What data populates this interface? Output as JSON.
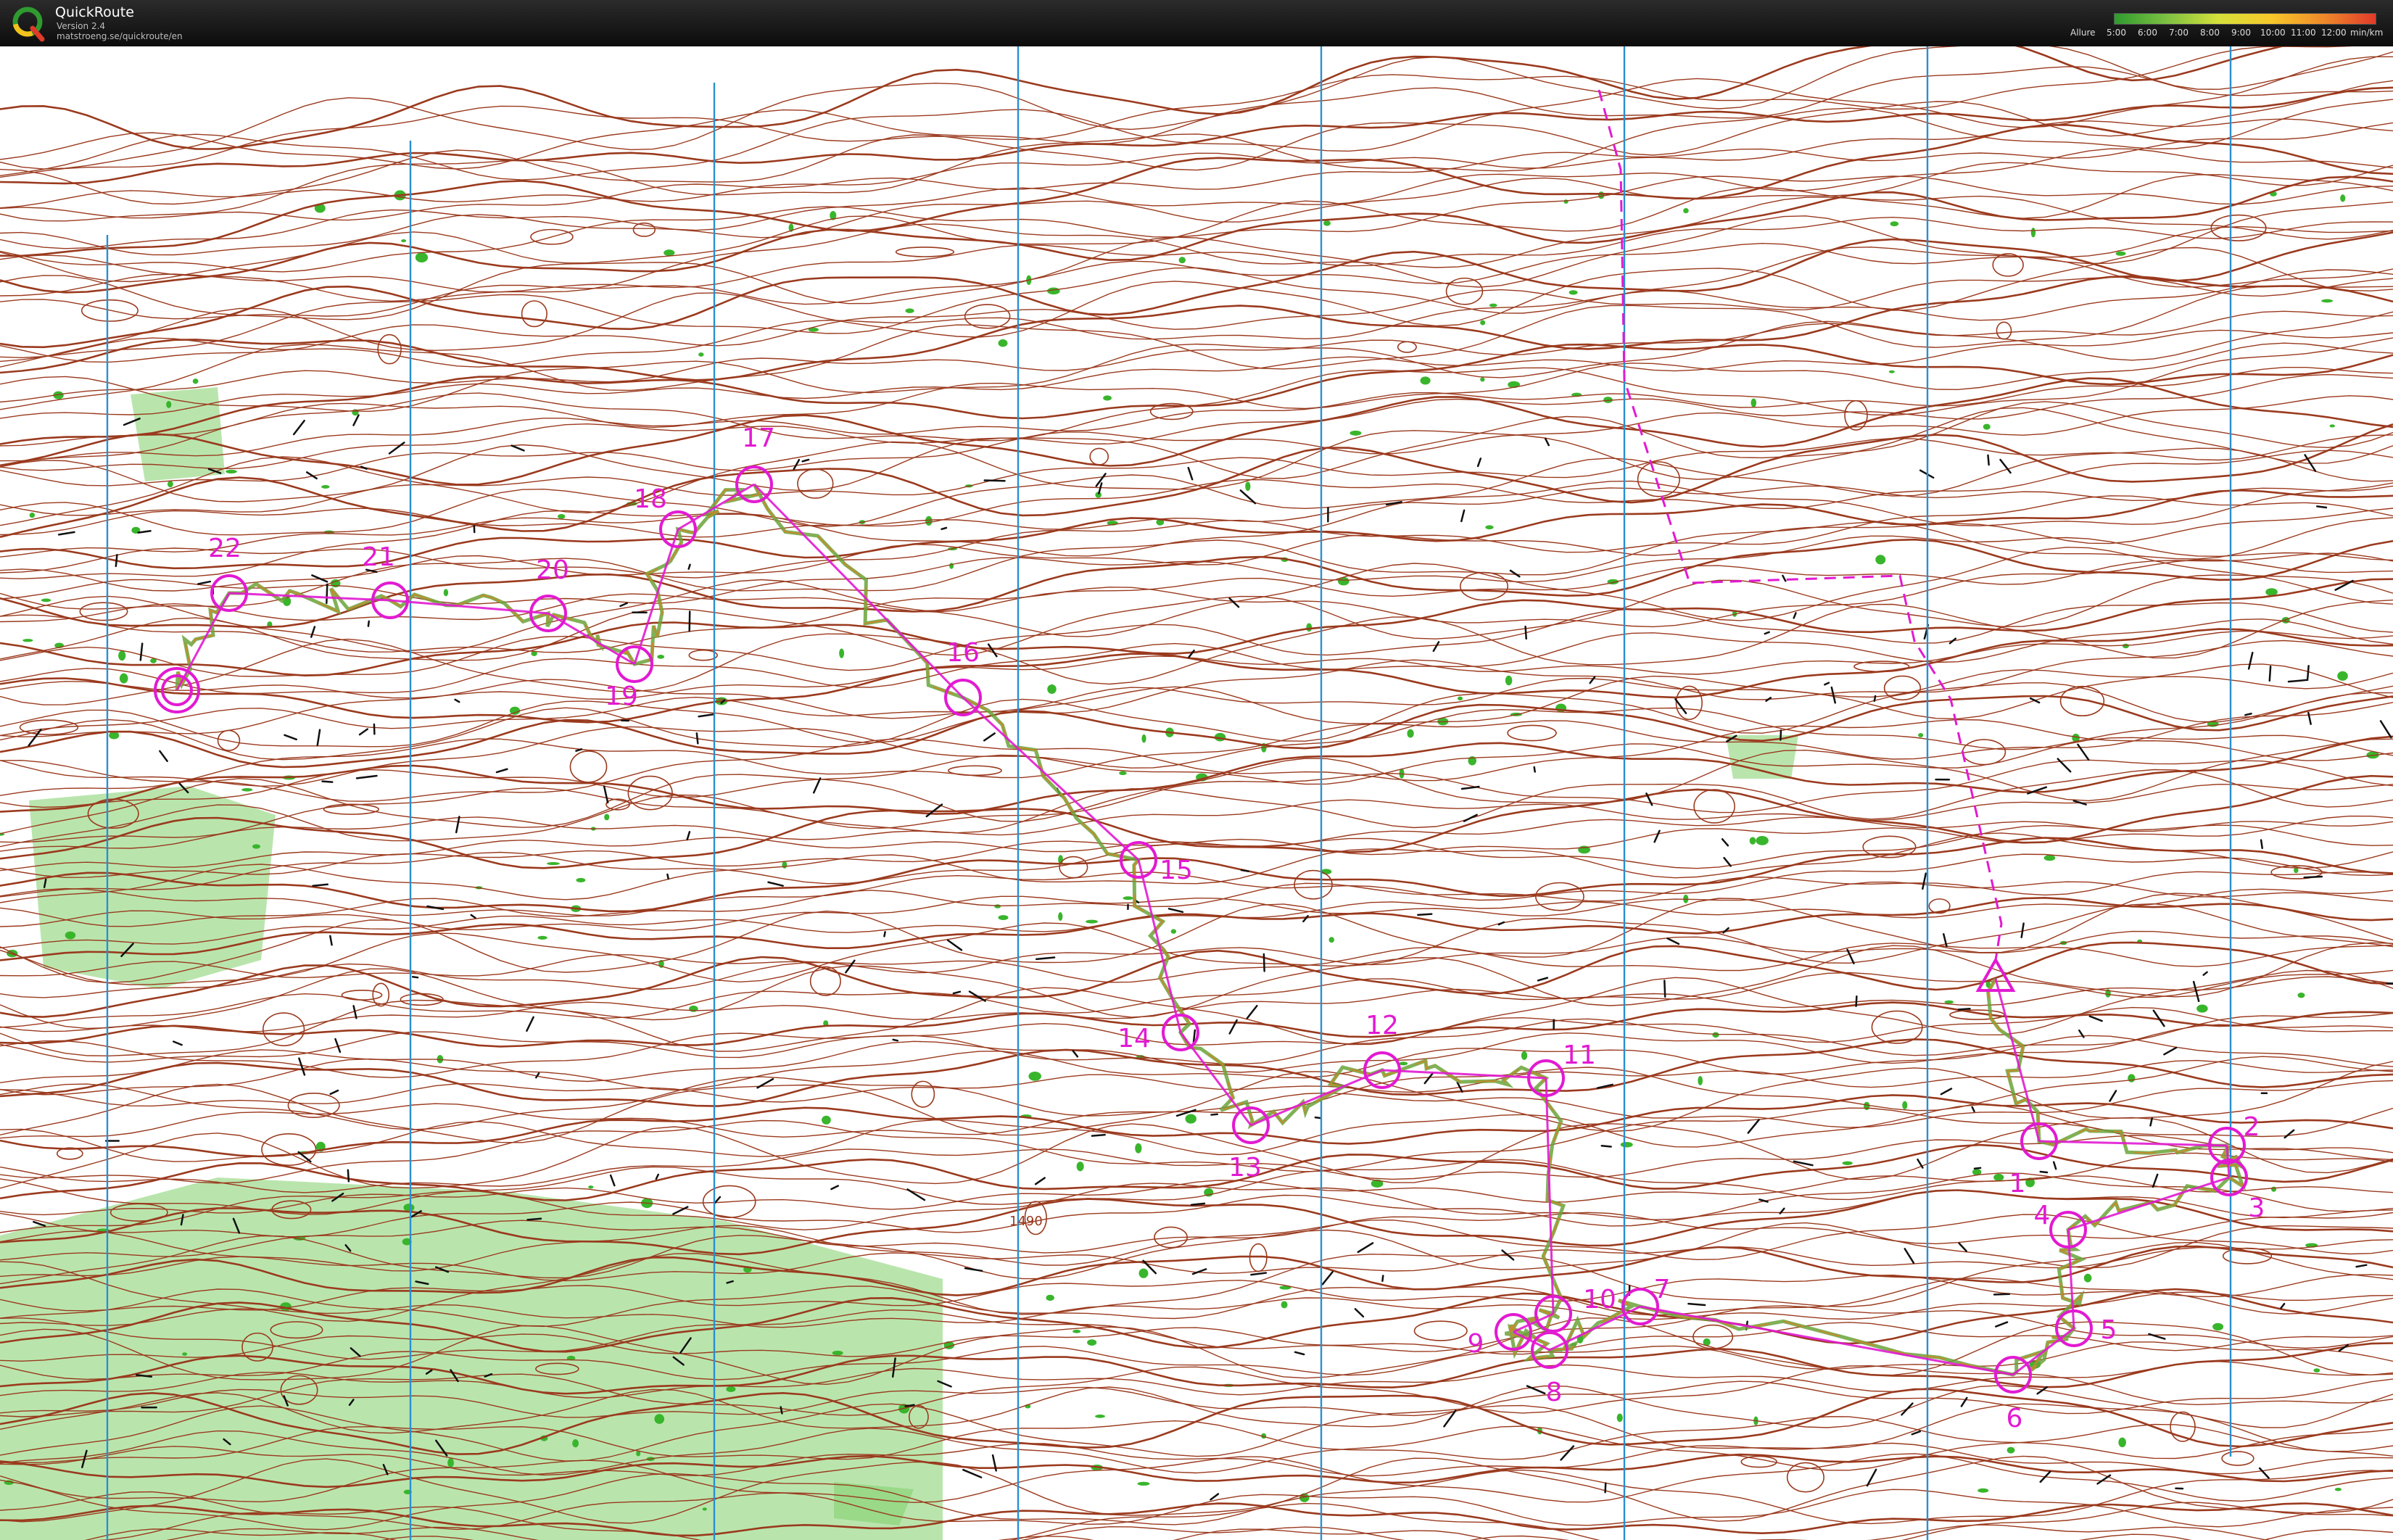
{
  "app": {
    "title": "QuickRoute",
    "version": "Version 2.4",
    "url": "matstroeng.se/quickroute/en"
  },
  "pace_legend": {
    "label": "Allure",
    "ticks": [
      "5:00",
      "6:00",
      "7:00",
      "8:00",
      "9:00",
      "10:00",
      "11:00",
      "12:00"
    ],
    "unit": "min/km",
    "gradient_colors": [
      "#2f9a2f",
      "#7dc142",
      "#d6e03a",
      "#f6c82a",
      "#f08a2a",
      "#e03a2a"
    ]
  },
  "colors": {
    "contour": "#9a3a1e",
    "vegetation_green": "#7fd06a",
    "north_lines": "#2a8fd0",
    "course": "#e21ad2",
    "rock": "#111111"
  },
  "map": {
    "spot_height": "1490",
    "start_icon": "start-triangle-icon",
    "finish_icon": "finish-double-circle-icon",
    "controls": [
      {
        "label": "1"
      },
      {
        "label": "2"
      },
      {
        "label": "3"
      },
      {
        "label": "4"
      },
      {
        "label": "5"
      },
      {
        "label": "6"
      },
      {
        "label": "7"
      },
      {
        "label": "8"
      },
      {
        "label": "9"
      },
      {
        "label": "10"
      },
      {
        "label": "11"
      },
      {
        "label": "12"
      },
      {
        "label": "13"
      },
      {
        "label": "14"
      },
      {
        "label": "15"
      },
      {
        "label": "16"
      },
      {
        "label": "17"
      },
      {
        "label": "18"
      },
      {
        "label": "19"
      },
      {
        "label": "20"
      },
      {
        "label": "21"
      },
      {
        "label": "22"
      }
    ]
  }
}
